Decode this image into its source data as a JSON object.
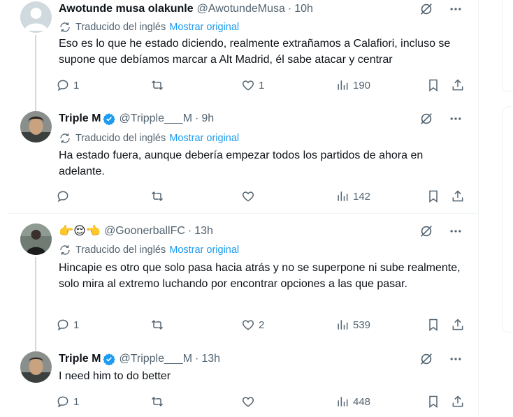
{
  "translation": {
    "label": "Traducido del inglés",
    "show_original": "Mostrar original"
  },
  "tweets": [
    {
      "name": "Awotunde musa olakunle",
      "handle": "@AwotundeMusa",
      "separator": "·",
      "time": "10h",
      "verified": false,
      "text": "Eso es lo que he estado diciendo, realmente extrañamos a Calafiori, incluso se supone que debíamos marcar a Alt Madrid, él sabe atacar y centrar",
      "replies": "1",
      "retweets": "",
      "likes": "1",
      "views": "190"
    },
    {
      "name": "Triple M",
      "handle": "@Tripple___M",
      "separator": "·",
      "time": "9h",
      "verified": true,
      "text": "Ha estado fuera, aunque debería empezar todos los partidos de ahora en adelante.",
      "replies": "",
      "retweets": "",
      "likes": "",
      "views": "142"
    },
    {
      "name": "",
      "emojis": "👉😌👈",
      "handle": "@GoonerballFC",
      "separator": "·",
      "time": "13h",
      "verified": false,
      "text": "Hincapie es otro que solo pasa hacia atrás y no se superpone ni sube realmente, solo mira al extremo luchando por encontrar opciones a las que pasar.",
      "replies": "1",
      "retweets": "",
      "likes": "2",
      "views": "539"
    },
    {
      "name": "Triple M",
      "handle": "@Tripple___M",
      "separator": "·",
      "time": "13h",
      "verified": true,
      "text": "I need him to do better",
      "replies": "1",
      "retweets": "",
      "likes": "",
      "views": "448"
    }
  ],
  "colors": {
    "accent": "#1d9bf0",
    "secondary_text": "#536471",
    "primary_text": "#0f1419",
    "divider": "#eff3f4",
    "thread_line": "#cfd9de"
  },
  "icons": [
    "grok-slash-icon",
    "more-icon",
    "translate-icon",
    "reply-icon",
    "retweet-icon",
    "like-icon",
    "views-icon",
    "bookmark-icon",
    "share-icon",
    "verified-badge-icon"
  ]
}
